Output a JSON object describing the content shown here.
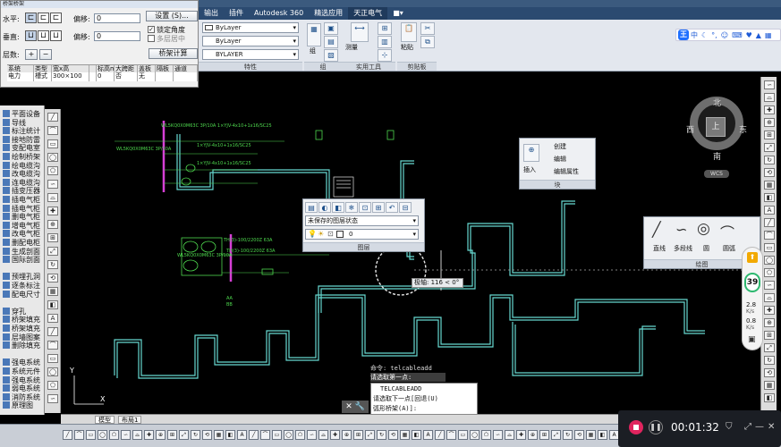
{
  "menubar": {
    "items": [
      "输出",
      "插件",
      "Autodesk 360",
      "精选应用",
      "天正电气",
      "■▾"
    ]
  },
  "ribbon": {
    "properties": {
      "title": "特性",
      "color_value": "ByLayer",
      "linetype_value": "ByLayer",
      "lineweight_value": "BYLAYER"
    },
    "group_panel": {
      "title": "组",
      "label": "组"
    },
    "utility_panel": {
      "title": "实用工具",
      "measure_label": "测量"
    },
    "clipboard_panel": {
      "title": "剪贴板",
      "paste_label": "粘贴"
    }
  },
  "dialog": {
    "title": "桥架桥架",
    "horizontal_label": "水平:",
    "vertical_label": "垂直:",
    "offset_label_1": "偏移:",
    "offset_label_2": "偏移:",
    "offset_value_1": "0",
    "offset_value_2": "0",
    "settings_button": "设置 (S)...",
    "lock_angle_label": "锁定角度",
    "multilayer_label": "多层居中",
    "layers_label": "层数:",
    "calc_button": "桥架计算",
    "grid_headers": [
      "系统",
      "类型",
      "宽x高",
      "",
      "标高m",
      "大跨距",
      "盖板",
      "隔板",
      "通道"
    ],
    "grid_row": [
      "电力",
      "槽式",
      "300×100",
      "",
      "0",
      "否",
      "无",
      "",
      ""
    ]
  },
  "left_palette": {
    "items": [
      "平面设备",
      "导线",
      "标注统计",
      "接地防雷",
      "变配电室",
      "绘制桥架",
      "绘电缆沟",
      "改电缆沟",
      "连电缆沟",
      "插变压器",
      "插电气柜",
      "插电气柜",
      "删电气柜",
      "增电气柜",
      "改电气柜",
      "删配电柜",
      "生成剖面",
      "国际剖面",
      "",
      "预埋孔洞",
      "逐条标注",
      "配电尺寸",
      "",
      "穿孔",
      "桥架填充",
      "桥架填充",
      "层墙图案",
      "删除填充",
      "",
      "强电系统",
      "系统元件",
      "强电系统",
      "弱电系统",
      "消防系统",
      "原理图"
    ]
  },
  "block_panel": {
    "title": "块",
    "insert_label": "插入",
    "create_label": "创建",
    "edit_label": "编辑",
    "edit_attr_label": "编辑属性"
  },
  "layer_panel": {
    "title": "图层",
    "state_value": "未保存的图层状态",
    "layer_value": "0"
  },
  "draw_panel": {
    "title": "绘图",
    "line_label": "直线",
    "polyline_label": "多段线",
    "circle_label": "圆",
    "arc_label": "圆弧"
  },
  "compass": {
    "north": "北",
    "south": "南",
    "east": "东",
    "west": "西",
    "top": "上",
    "wcs": "WCS"
  },
  "drawing": {
    "polar_tooltip": "极轴: 116 < 0°",
    "annotations": [
      "WL5KQ0X0M63C 3P/10A 1×YJV-4x10+1x16/SC25",
      "1×YJV-4x10+1x16/SC25",
      "1×YJV-4x10+1x16/SC25",
      "WL5KQ0X0M63C 3P/10A",
      "TH(3)-100/2200Z 63A",
      "TH(3)-100/2200Z 63A",
      "WL5KQ0X0M63C 3P/10A",
      "AA",
      "BB"
    ]
  },
  "command": {
    "line1": "命令: telcableadd",
    "line2": "请选取第一点:",
    "cmd_name": "TELCABLEADD",
    "prompt": "请选取下一点[回退(U)",
    "prompt2": "弧形桥架(A)]:"
  },
  "tabs": {
    "model": "模型",
    "layout1": "布局1"
  },
  "recorder": {
    "time": "00:01:32"
  },
  "network": {
    "badge": "39",
    "up": "2.8",
    "up_unit": "K/s",
    "down": "0.8",
    "down_unit": "K/s"
  },
  "ime": {
    "logo": "王",
    "lang": "中"
  },
  "colors": {
    "cable": "#66d8d0",
    "annotation": "#4ed84e",
    "magenta": "#d63fd6",
    "background": "#000000"
  }
}
